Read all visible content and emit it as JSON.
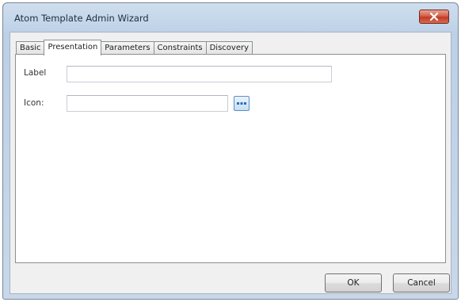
{
  "window": {
    "title": "Atom Template Admin Wizard"
  },
  "tabs": [
    {
      "label": "Basic",
      "active": false
    },
    {
      "label": "Presentation",
      "active": true
    },
    {
      "label": "Parameters",
      "active": false
    },
    {
      "label": "Constraints",
      "active": false
    },
    {
      "label": "Discovery",
      "active": false
    }
  ],
  "form": {
    "label_field": {
      "label": "Label",
      "value": ""
    },
    "icon_field": {
      "label": "Icon:",
      "value": ""
    }
  },
  "buttons": {
    "ok": "OK",
    "cancel": "Cancel"
  },
  "icons": {
    "close": "close-icon",
    "browse": "ellipsis-icon"
  },
  "colors": {
    "close_button": "#c9442c",
    "browse_button": "#2a6fbf"
  }
}
